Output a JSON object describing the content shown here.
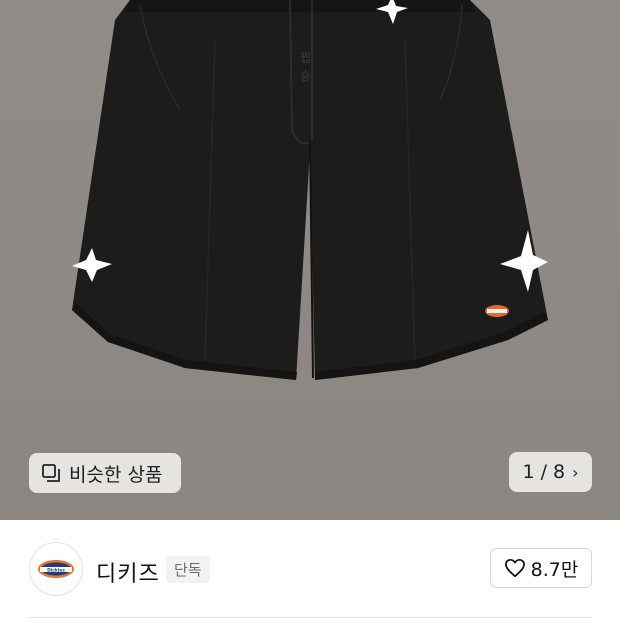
{
  "hero": {
    "similar_button_label": "비슷한 상품",
    "similar_icon": "similar-products-icon",
    "page_indicator": "1 / 8",
    "next_icon": "chevron-right-icon",
    "background_color": "#8e8985"
  },
  "brand": {
    "name": "디키즈",
    "badge": "단독",
    "logo_icon": "dickies-logo",
    "logo_text": "Dickies",
    "like_icon": "heart-outline-icon",
    "like_count": "8.7만"
  }
}
